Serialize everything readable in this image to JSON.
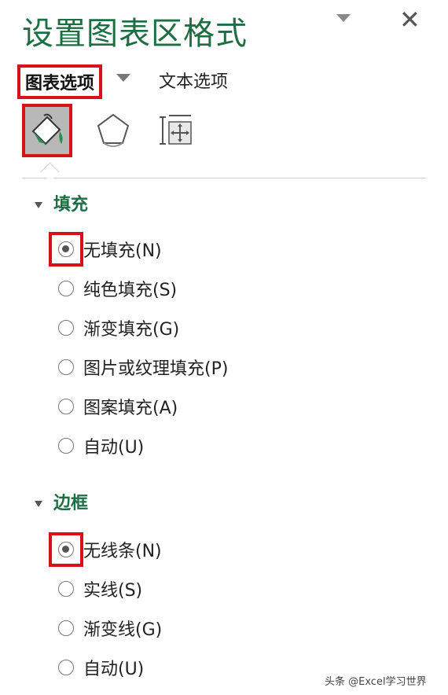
{
  "panel": {
    "title": "设置图表区格式"
  },
  "tabs": {
    "chart_options": "图表选项",
    "text_options": "文本选项"
  },
  "fill": {
    "header": "填充",
    "options": [
      {
        "label": "无填充(N)",
        "selected": true
      },
      {
        "label": "纯色填充(S)",
        "selected": false
      },
      {
        "label": "渐变填充(G)",
        "selected": false
      },
      {
        "label": "图片或纹理填充(P)",
        "selected": false
      },
      {
        "label": "图案填充(A)",
        "selected": false
      },
      {
        "label": "自动(U)",
        "selected": false
      }
    ]
  },
  "border": {
    "header": "边框",
    "options": [
      {
        "label": "无线条(N)",
        "selected": true
      },
      {
        "label": "实线(S)",
        "selected": false
      },
      {
        "label": "渐变线(G)",
        "selected": false
      },
      {
        "label": "自动(U)",
        "selected": false
      }
    ]
  },
  "watermark": "头条 @Excel学习世界",
  "colors": {
    "accent": "#1e6e43",
    "highlight": "#d9101a"
  }
}
